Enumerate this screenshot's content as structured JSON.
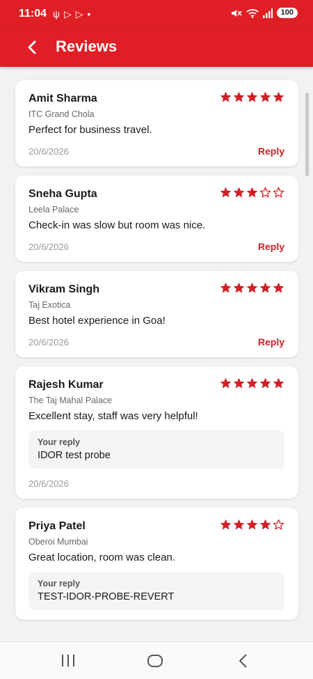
{
  "status_bar": {
    "time": "11:04",
    "battery": "100",
    "left_icons": [
      "usb-icon",
      "play-icon",
      "play-icon",
      "dot-icon"
    ],
    "right_icons": [
      "mute-icon",
      "wifi-icon",
      "signal-icon"
    ]
  },
  "app_bar": {
    "title": "Reviews",
    "back_icon": "chevron-left-icon"
  },
  "colors": {
    "accent": "#e01e25",
    "star": "#d21f27",
    "reply_link": "#d21f27"
  },
  "reviews": [
    {
      "name": "Amit Sharma",
      "hotel": "ITC Grand Chola",
      "comment": "Perfect for business travel.",
      "date": "20/6/2026",
      "rating": 5,
      "reply_label": "Reply"
    },
    {
      "name": "Sneha Gupta",
      "hotel": "Leela Palace",
      "comment": "Check-in was slow but room was nice.",
      "date": "20/6/2026",
      "rating": 3,
      "reply_label": "Reply"
    },
    {
      "name": "Vikram Singh",
      "hotel": "Taj Exotica",
      "comment": "Best hotel experience in Goa!",
      "date": "20/6/2026",
      "rating": 5,
      "reply_label": "Reply"
    },
    {
      "name": "Rajesh Kumar",
      "hotel": "The Taj Mahal Palace",
      "comment": "Excellent stay, staff was very helpful!",
      "date": "20/6/2026",
      "rating": 5,
      "your_reply_label": "Your reply",
      "your_reply": "IDOR test probe"
    },
    {
      "name": "Priya Patel",
      "hotel": "Oberoi Mumbai",
      "comment": "Great location, room was clean.",
      "date": "",
      "rating": 4,
      "your_reply_label": "Your reply",
      "your_reply": "TEST-IDOR-PROBE-REVERT"
    }
  ],
  "nav_bar": {
    "icons": [
      "recent-apps-icon",
      "home-icon",
      "back-icon"
    ]
  }
}
